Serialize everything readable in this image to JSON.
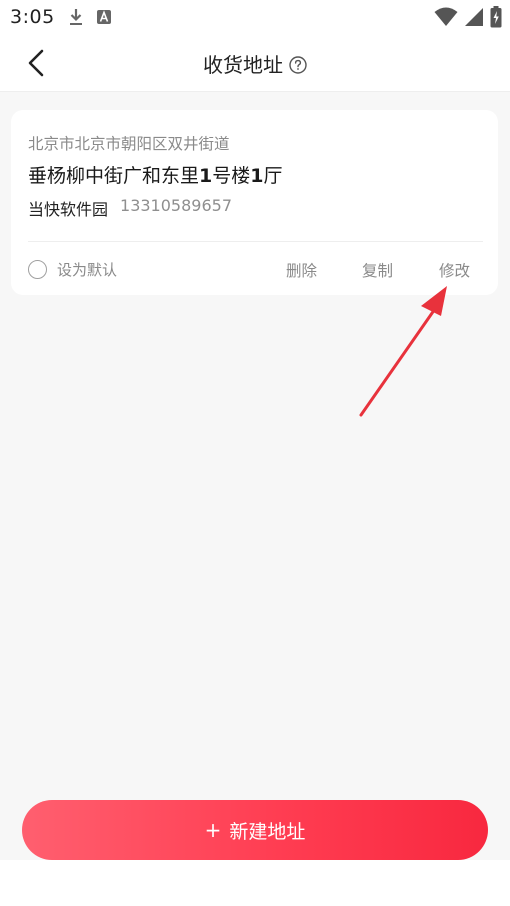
{
  "status_bar": {
    "time": "3:05",
    "icons": [
      "download-icon",
      "a-letter-icon",
      "wifi-icon",
      "signal-icon",
      "battery-charging-icon"
    ]
  },
  "nav": {
    "title": "收货地址",
    "back_icon": "back-chevron-icon",
    "help_icon": "question-circle-icon"
  },
  "address_card": {
    "region": "北京市北京市朝阳区双井街道",
    "detail_prefix": "垂杨柳中街广和东里",
    "detail_num1": "1",
    "detail_mid": "号楼",
    "detail_num2": "1",
    "detail_suffix": "厅",
    "contact_name": "当快软件园",
    "phone": "13310589657",
    "default_label": "设为默认",
    "actions": {
      "delete": "删除",
      "copy": "复制",
      "edit": "修改"
    }
  },
  "annotation": {
    "arrow_color": "#e8323c"
  },
  "new_address_button": {
    "plus": "+",
    "label": "新建地址",
    "gradient_start": "#ff5f6f",
    "gradient_end": "#f8283f"
  }
}
